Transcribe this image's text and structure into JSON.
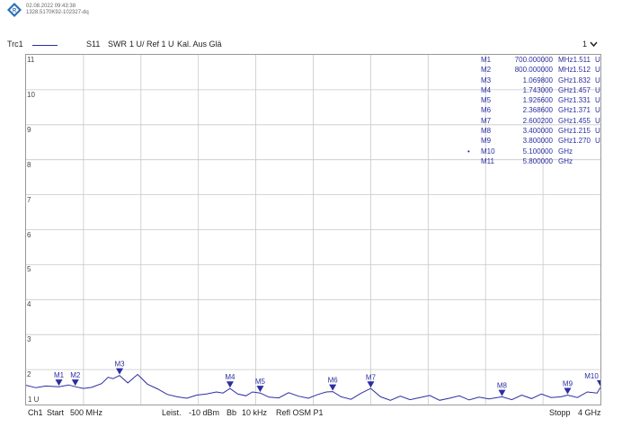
{
  "header": {
    "timestamp": "02.08.2022 09:43:38",
    "device_id": "1328.5170K92-102327-dq"
  },
  "trace": {
    "name": "Trc1",
    "param": "S11",
    "format": "SWR",
    "scale": "1 U/ Ref 1 U",
    "cal": "Kal. Aus Glä",
    "channel_indicator": "1",
    "ref_label": "1 U"
  },
  "axis": {
    "y_labels": [
      "11",
      "10",
      "9",
      "8",
      "7",
      "6",
      "5",
      "4",
      "3",
      "2"
    ]
  },
  "markers": [
    {
      "id": "M1",
      "active": false,
      "freq": "700.000000",
      "unit": "MHz",
      "value": "1.511",
      "vunit": "U"
    },
    {
      "id": "M2",
      "active": false,
      "freq": "800.000000",
      "unit": "MHz",
      "value": "1.512",
      "vunit": "U"
    },
    {
      "id": "M3",
      "active": false,
      "freq": "1.069800",
      "unit": "GHz",
      "value": "1.832",
      "vunit": "U"
    },
    {
      "id": "M4",
      "active": false,
      "freq": "1.743000",
      "unit": "GHz",
      "value": "1.457",
      "vunit": "U"
    },
    {
      "id": "M5",
      "active": false,
      "freq": "1.926600",
      "unit": "GHz",
      "value": "1.331",
      "vunit": "U"
    },
    {
      "id": "M6",
      "active": false,
      "freq": "2.368600",
      "unit": "GHz",
      "value": "1.371",
      "vunit": "U"
    },
    {
      "id": "M7",
      "active": false,
      "freq": "2.600200",
      "unit": "GHz",
      "value": "1.455",
      "vunit": "U"
    },
    {
      "id": "M8",
      "active": false,
      "freq": "3.400000",
      "unit": "GHz",
      "value": "1.215",
      "vunit": "U"
    },
    {
      "id": "M9",
      "active": false,
      "freq": "3.800000",
      "unit": "GHz",
      "value": "1.270",
      "vunit": "U"
    },
    {
      "id": "M10",
      "active": true,
      "freq": "5.100000",
      "unit": "GHz",
      "value": "",
      "vunit": ""
    },
    {
      "id": "M11",
      "active": false,
      "freq": "5.800000",
      "unit": "GHz",
      "value": "",
      "vunit": ""
    }
  ],
  "status": {
    "channel": "Ch1",
    "start_label": "Start",
    "start_value": "500 MHz",
    "power_label": "Leist.",
    "power_value": "-10 dBm",
    "bw_label": "Bb",
    "bw_value": "10 kHz",
    "port": "Refl OSM P1",
    "stop_label": "Stopp",
    "stop_value": "4 GHz"
  },
  "colors": {
    "trace": "#2b2fa0",
    "grid": "#c8c8c8"
  },
  "chart_data": {
    "type": "line",
    "xlim": [
      500,
      4000
    ],
    "ylim": [
      1,
      11
    ],
    "x": [
      500,
      560,
      620,
      700,
      760,
      800,
      850,
      900,
      960,
      1000,
      1030,
      1069.8,
      1120,
      1180,
      1240,
      1300,
      1360,
      1420,
      1480,
      1540,
      1600,
      1660,
      1700,
      1743,
      1790,
      1840,
      1880,
      1926.6,
      1980,
      2040,
      2100,
      2160,
      2220,
      2280,
      2330,
      2368.6,
      2420,
      2480,
      2540,
      2600.2,
      2660,
      2720,
      2780,
      2840,
      2900,
      2960,
      3020,
      3080,
      3140,
      3200,
      3260,
      3320,
      3400,
      3460,
      3520,
      3580,
      3640,
      3700,
      3760,
      3800,
      3860,
      3920,
      3980,
      4000
    ],
    "y": [
      1.55,
      1.48,
      1.53,
      1.51,
      1.56,
      1.51,
      1.46,
      1.49,
      1.6,
      1.78,
      1.74,
      1.83,
      1.62,
      1.86,
      1.58,
      1.45,
      1.29,
      1.22,
      1.18,
      1.27,
      1.3,
      1.36,
      1.33,
      1.46,
      1.3,
      1.25,
      1.36,
      1.33,
      1.21,
      1.19,
      1.34,
      1.24,
      1.18,
      1.29,
      1.36,
      1.37,
      1.22,
      1.15,
      1.32,
      1.46,
      1.22,
      1.12,
      1.24,
      1.14,
      1.2,
      1.26,
      1.12,
      1.18,
      1.25,
      1.13,
      1.21,
      1.16,
      1.22,
      1.14,
      1.27,
      1.17,
      1.3,
      1.2,
      1.22,
      1.27,
      1.2,
      1.36,
      1.33,
      1.49
    ],
    "marker_x": [
      700,
      800,
      1069.8,
      1743,
      1926.6,
      2368.6,
      2600.2,
      3400,
      3800,
      4000
    ],
    "marker_y": [
      1.511,
      1.512,
      1.832,
      1.457,
      1.331,
      1.371,
      1.455,
      1.215,
      1.27,
      1.49
    ],
    "marker_labels": [
      "M1",
      "M2",
      "M3",
      "M4",
      "M5",
      "M6",
      "M7",
      "M8",
      "M9",
      "M10"
    ]
  }
}
